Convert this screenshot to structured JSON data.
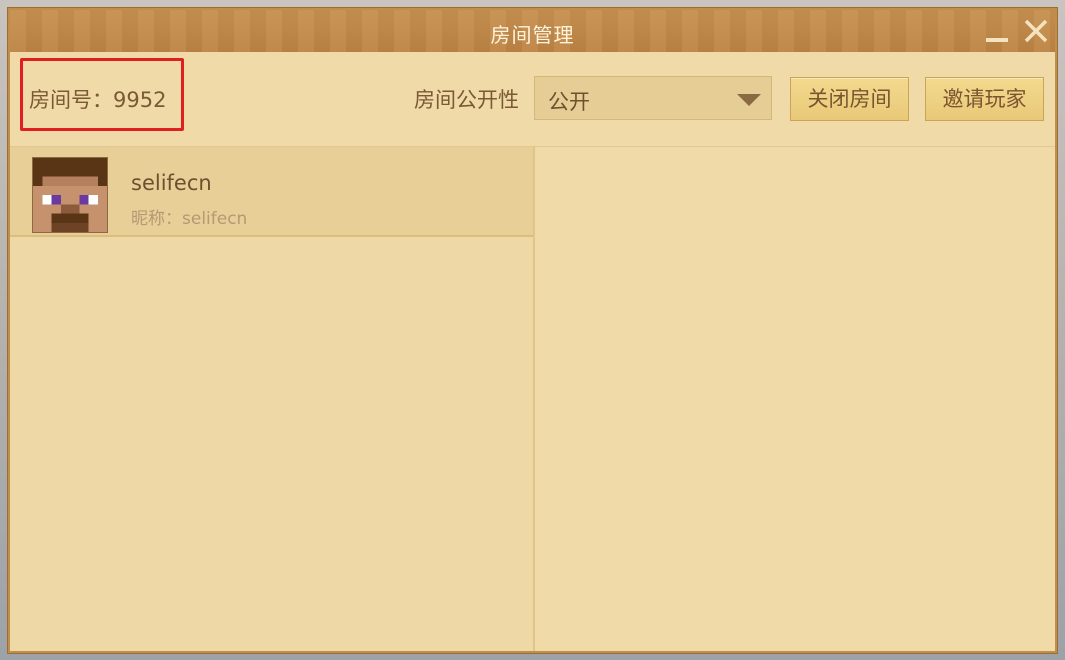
{
  "window": {
    "title": "房间管理"
  },
  "toolbar": {
    "room_id_label": "房间号：9952",
    "visibility_label": "房间公开性",
    "visibility_selected": "公开",
    "close_room_label": "关闭房间",
    "invite_label": "邀请玩家"
  },
  "players": [
    {
      "name": "selifecn",
      "nickname_label": "昵称：selifecn",
      "avatar_icon": "steve-head-icon"
    }
  ],
  "colors": {
    "titlebar": "#bd8444",
    "panel": "#efdaa8",
    "button": "#eccd7e",
    "highlight": "#e02020",
    "text": "#7a5a35"
  }
}
